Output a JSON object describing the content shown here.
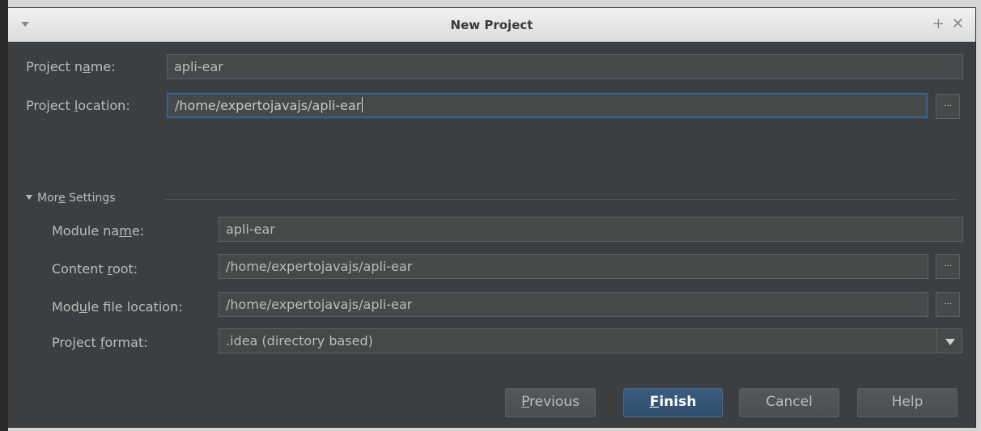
{
  "window": {
    "title": "New Project",
    "buttons": {
      "plus": "+",
      "close": "✕"
    }
  },
  "project_name": {
    "label_pre": "Project n",
    "label_mnemonic": "a",
    "label_post": "me:",
    "value": "apli-ear"
  },
  "project_location": {
    "label_pre": "Project ",
    "label_mnemonic": "l",
    "label_post": "ocation:",
    "value": "/home/expertojavajs/apli-ear",
    "browse": "···"
  },
  "more_settings": {
    "label_pre": "Mor",
    "label_mnemonic": "e",
    "label_post": " Settings"
  },
  "module_name": {
    "label_pre": "Module na",
    "label_mnemonic": "m",
    "label_post": "e:",
    "value": "apli-ear"
  },
  "content_root": {
    "label_pre": "Content ",
    "label_mnemonic": "r",
    "label_post": "oot:",
    "value": "/home/expertojavajs/apli-ear",
    "browse": "···"
  },
  "module_file_location": {
    "label_pre": "Mod",
    "label_mnemonic": "u",
    "label_post": "le file location:",
    "value": "/home/expertojavajs/apli-ear",
    "browse": "···"
  },
  "project_format": {
    "label_pre": "Project ",
    "label_mnemonic": "f",
    "label_post": "ormat:",
    "selected": ".idea (directory based)"
  },
  "footer": {
    "previous": {
      "mnemonic": "P",
      "rest": "revious"
    },
    "finish": {
      "mnemonic": "F",
      "rest": "inish"
    },
    "cancel": "Cancel",
    "help": "Help"
  }
}
